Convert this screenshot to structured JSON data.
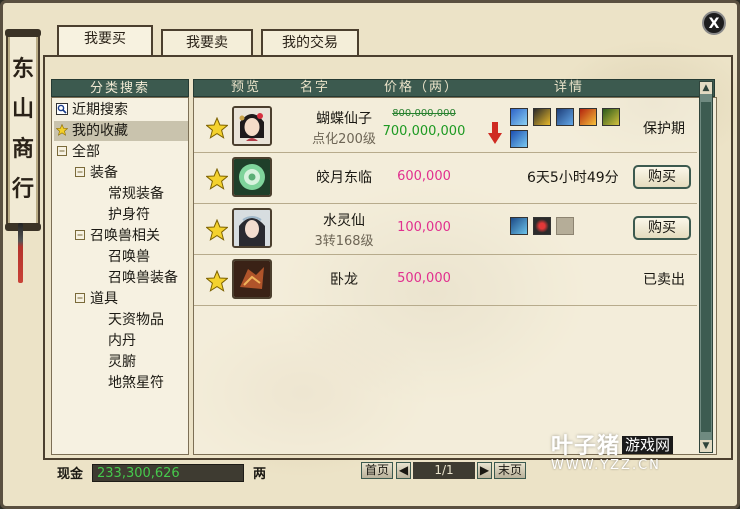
{
  "window": {
    "title_vertical": [
      "东",
      "山",
      "商",
      "行"
    ],
    "close_label": "X"
  },
  "tabs": [
    {
      "label": "我要买",
      "active": true
    },
    {
      "label": "我要卖",
      "active": false
    },
    {
      "label": "我的交易",
      "active": false
    }
  ],
  "category": {
    "header": "分类搜索",
    "items": [
      {
        "label": "近期搜索",
        "icon": "search-icon",
        "indent": 0
      },
      {
        "label": "我的收藏",
        "icon": "star-icon",
        "indent": 0,
        "selected": true
      },
      {
        "label": "全部",
        "icon": "minus-box-icon",
        "indent": 0
      },
      {
        "label": "装备",
        "icon": "minus-box-icon",
        "indent": 1
      },
      {
        "label": "常规装备",
        "indent": 2
      },
      {
        "label": "护身符",
        "indent": 2
      },
      {
        "label": "召唤兽相关",
        "icon": "minus-box-icon",
        "indent": 1
      },
      {
        "label": "召唤兽",
        "indent": 2
      },
      {
        "label": "召唤兽装备",
        "indent": 2
      },
      {
        "label": "道具",
        "icon": "minus-box-icon",
        "indent": 1
      },
      {
        "label": "天资物品",
        "indent": 2
      },
      {
        "label": "内丹",
        "indent": 2
      },
      {
        "label": "灵腑",
        "indent": 2
      },
      {
        "label": "地煞星符",
        "indent": 2
      }
    ]
  },
  "columns": {
    "preview": "预览",
    "name": "名字",
    "price": "价格（两）",
    "detail": "详情"
  },
  "rows": [
    {
      "name": "蝴蝶仙子",
      "sub": "点化200级",
      "old_price": "800,000,000",
      "price": "700,000,000",
      "price_color": "#1d9a22",
      "status": "保护期",
      "button": ""
    },
    {
      "name": "皎月东临",
      "sub": "",
      "old_price": "",
      "price": "600,000",
      "price_color": "#e1308f",
      "status": "6天5小时49分",
      "button": "购买"
    },
    {
      "name": "水灵仙",
      "sub": "3转168级",
      "old_price": "",
      "price": "100,000",
      "price_color": "#e1308f",
      "status": "",
      "button": "购买"
    },
    {
      "name": "卧龙",
      "sub": "",
      "old_price": "",
      "price": "500,000",
      "price_color": "#e1308f",
      "status": "已卖出",
      "button": ""
    }
  ],
  "footer": {
    "money_label": "现金",
    "money_value": "233,300,626",
    "money_unit": "两",
    "first_page": "首页",
    "page": "1/1",
    "last_page": "末页"
  },
  "watermark": {
    "text": "叶子猪",
    "tag": "游戏网",
    "url": "WWW.YZZ.CN"
  }
}
